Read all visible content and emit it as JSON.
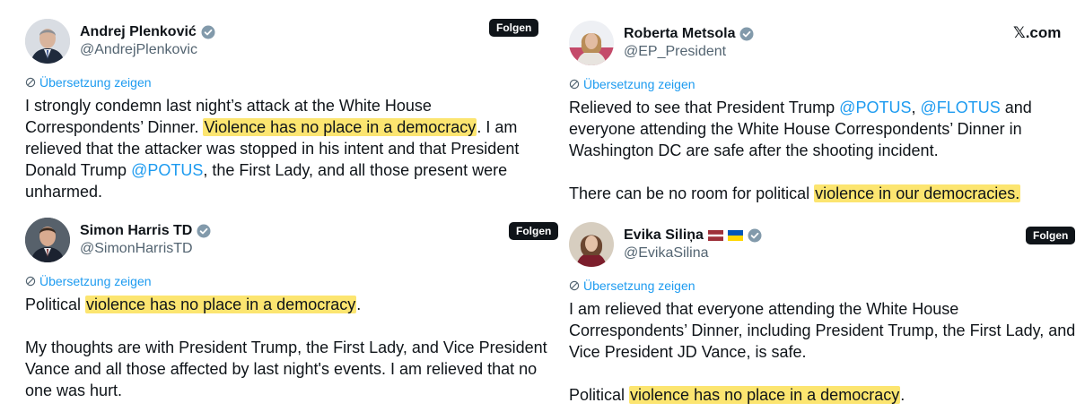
{
  "site": "𝕏.com",
  "follow_label": "Folgen",
  "translate_label": "Übersetzung zeigen",
  "colors": {
    "highlight": "#fce570",
    "link": "#1d9bf0",
    "handle": "#536471",
    "verified_badge": "#829aab"
  },
  "tweets": [
    {
      "display_name": "Andrej Plenković",
      "handle": "@AndrejPlenkovic",
      "avatar_icon": "avatar-andrej-plenkovic",
      "badge_icon": "verified-gray-badge-icon",
      "p1_a": "I strongly condemn last night’s attack at the White House Correspondents’ Dinner. ",
      "p1_hl": "Violence has no place in a democracy",
      "p1_b": ". I am relieved that the attacker was stopped in his intent and that President Donald Trump ",
      "p1_mention": "@POTUS",
      "p1_c": ", the First Lady, and all those present were unharmed."
    },
    {
      "display_name": "Roberta Metsola",
      "handle": "@EP_President",
      "avatar_icon": "avatar-roberta-metsola",
      "badge_icon": "verified-gray-badge-icon",
      "p1_a": "Relieved to see that President Trump ",
      "p1_m1": "@POTUS",
      "p1_b": ", ",
      "p1_m2": "@FLOTUS",
      "p1_c": " and everyone attending the White House Correspondents’ Dinner in Washington DC are safe after the shooting incident.",
      "p2_a": "There can be no room for political ",
      "p2_hl": "violence in our democracies."
    },
    {
      "display_name": "Simon Harris TD",
      "handle": "@SimonHarrisTD",
      "avatar_icon": "avatar-simon-harris",
      "badge_icon": "verified-gray-badge-icon",
      "p1_a": "Political ",
      "p1_hl": "violence has no place in a democracy",
      "p1_b": ".",
      "p2": "My thoughts are with President Trump, the First Lady, and Vice President Vance and all those affected by last night's events. I am relieved that no one was hurt."
    },
    {
      "display_name": "Evika Siliņa",
      "handle": "@EvikaSilina",
      "avatar_icon": "avatar-evika-silina",
      "badge_icon": "verified-gray-badge-icon",
      "flag_icons": [
        "latvia-flag-icon",
        "ukraine-flag-icon"
      ],
      "p1": "I am relieved that everyone attending the White House Correspondents’ Dinner, including President Trump, the First Lady, and Vice President JD Vance, is safe.",
      "p2_a": "Political ",
      "p2_hl": "violence has no place in a democracy",
      "p2_b": "."
    }
  ]
}
